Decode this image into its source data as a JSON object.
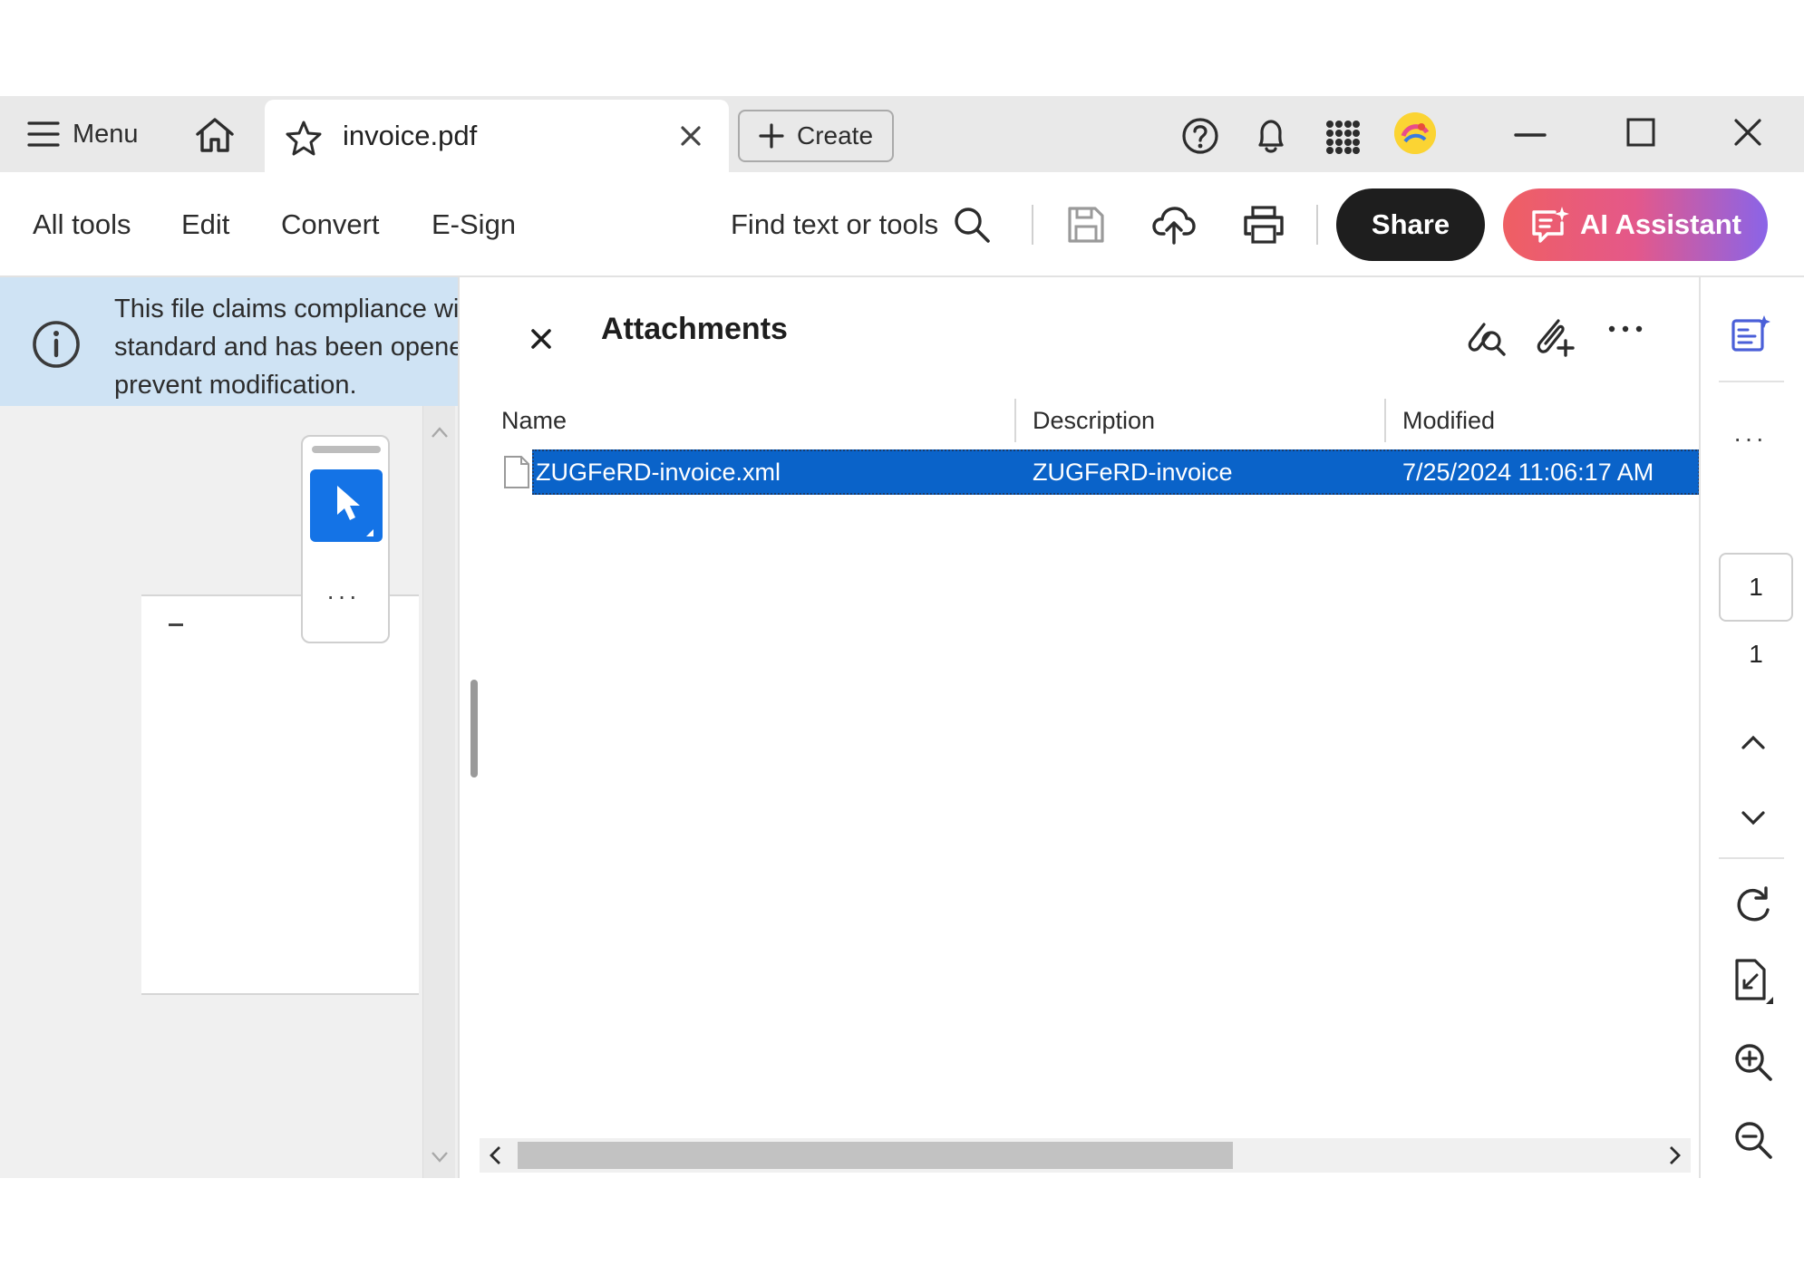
{
  "titlebar": {
    "menu_label": "Menu",
    "tab_title": "invoice.pdf",
    "create_label": "Create",
    "icons": [
      "menu-icon",
      "home-icon",
      "star-icon",
      "close-icon",
      "plus-icon",
      "help-icon",
      "bell-icon",
      "apps-grid-icon",
      "avatar",
      "minimize-icon",
      "maximize-icon",
      "window-close-icon"
    ]
  },
  "toolbar": {
    "all_tools": "All tools",
    "edit": "Edit",
    "convert": "Convert",
    "esign": "E-Sign",
    "find_label": "Find text or tools",
    "share_label": "Share",
    "ai_label": "AI Assistant",
    "icons": [
      "search-icon",
      "save-icon",
      "cloud-upload-icon",
      "print-icon",
      "ai-assistant-icon"
    ]
  },
  "banner": {
    "line1": "This file claims compliance with the PDF/A",
    "line2": "standard and has been opened read-only to",
    "line3": "prevent modification."
  },
  "quick_tools": {
    "more_label": "···"
  },
  "attachments": {
    "title": "Attachments",
    "columns": [
      "Name",
      "Description",
      "Modified"
    ],
    "rows": [
      {
        "name": "ZUGFeRD-invoice.xml",
        "description": "ZUGFeRD-invoice",
        "modified": "7/25/2024 11:06:17 AM",
        "selected": true
      }
    ],
    "hscroll_fraction": 0.63
  },
  "right_rail": {
    "current_page": "1",
    "total_pages": "1",
    "more_label": "···"
  },
  "colors": {
    "selection": "#0a63c9",
    "info_banner": "#cfe3f4",
    "accent_blue": "#1473e6",
    "share_bg": "#1e1e1e"
  }
}
